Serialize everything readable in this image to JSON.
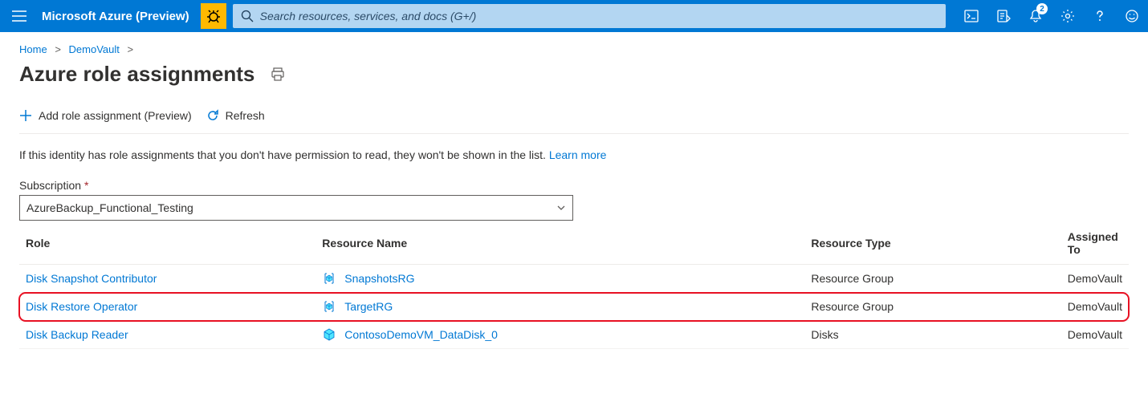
{
  "header": {
    "brand": "Microsoft Azure (Preview)",
    "search_placeholder": "Search resources, services, and docs (G+/)",
    "notification_count": "2"
  },
  "breadcrumb": {
    "items": [
      "Home",
      "DemoVault"
    ]
  },
  "page": {
    "title": "Azure role assignments"
  },
  "toolbar": {
    "add_label": "Add role assignment (Preview)",
    "refresh_label": "Refresh"
  },
  "info": {
    "text": "If this identity has role assignments that you don't have permission to read, they won't be shown in the list. ",
    "link": "Learn more"
  },
  "subscription": {
    "label": "Subscription",
    "value": "AzureBackup_Functional_Testing"
  },
  "table": {
    "headers": {
      "role": "Role",
      "resource_name": "Resource Name",
      "resource_type": "Resource Type",
      "assigned_to": "Assigned To"
    },
    "rows": [
      {
        "role": "Disk Snapshot Contributor",
        "resource_name": "SnapshotsRG",
        "resource_type": "Resource Group",
        "assigned_to": "DemoVault",
        "icon": "rg",
        "highlight": false
      },
      {
        "role": "Disk Restore Operator",
        "resource_name": "TargetRG",
        "resource_type": "Resource Group",
        "assigned_to": "DemoVault",
        "icon": "rg",
        "highlight": true
      },
      {
        "role": "Disk Backup Reader",
        "resource_name": "ContosoDemoVM_DataDisk_0",
        "resource_type": "Disks",
        "assigned_to": "DemoVault",
        "icon": "disk",
        "highlight": false
      }
    ]
  }
}
